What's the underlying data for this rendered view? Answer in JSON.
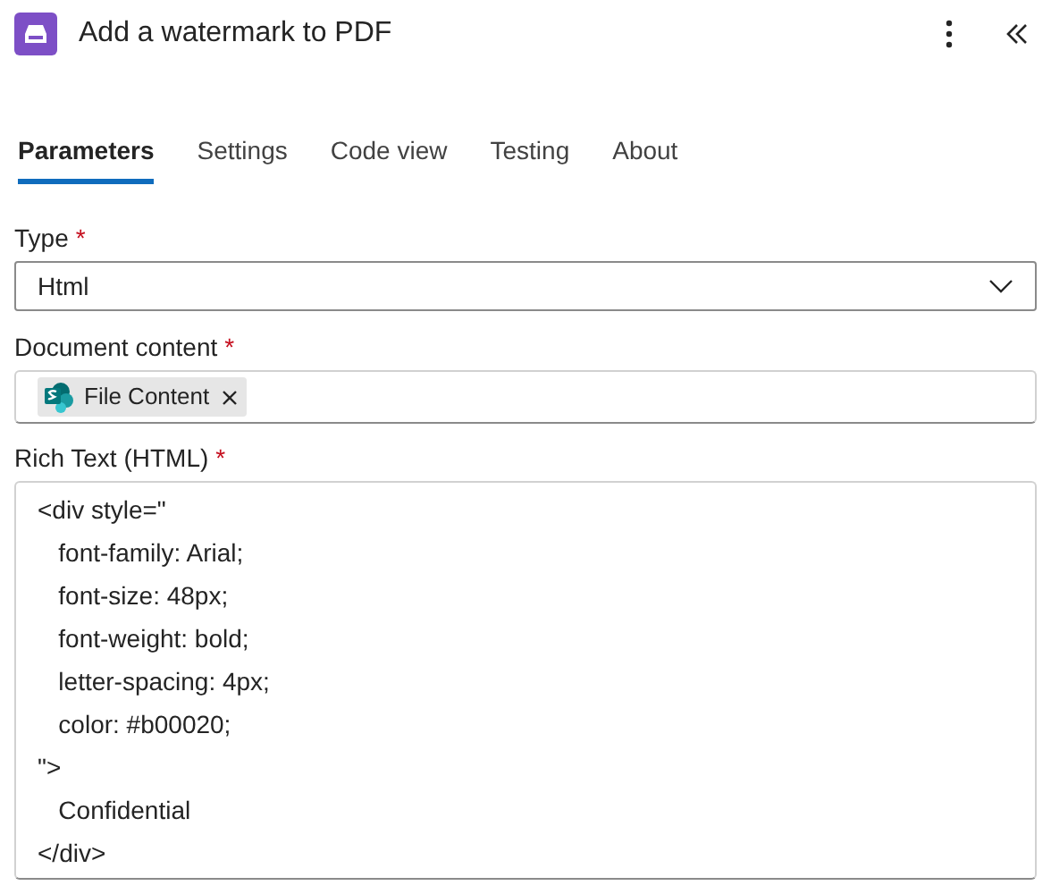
{
  "header": {
    "title": "Add a watermark to PDF"
  },
  "tabs": [
    {
      "label": "Parameters",
      "selected": true
    },
    {
      "label": "Settings",
      "selected": false
    },
    {
      "label": "Code view",
      "selected": false
    },
    {
      "label": "Testing",
      "selected": false
    },
    {
      "label": "About",
      "selected": false
    }
  ],
  "type_field": {
    "label": "Type",
    "required_mark": "*",
    "value": "Html"
  },
  "document_content": {
    "label": "Document content",
    "required_mark": "*",
    "token": "File Content"
  },
  "rich_text": {
    "label": "Rich Text (HTML)",
    "required_mark": "*",
    "lines": [
      "<div style=\"",
      "   font-family: Arial;",
      "   font-size: 48px;",
      "   font-weight: bold;",
      "   letter-spacing: 4px;",
      "   color: #b00020;",
      "\">",
      "   Confidential",
      "</div>"
    ]
  }
}
